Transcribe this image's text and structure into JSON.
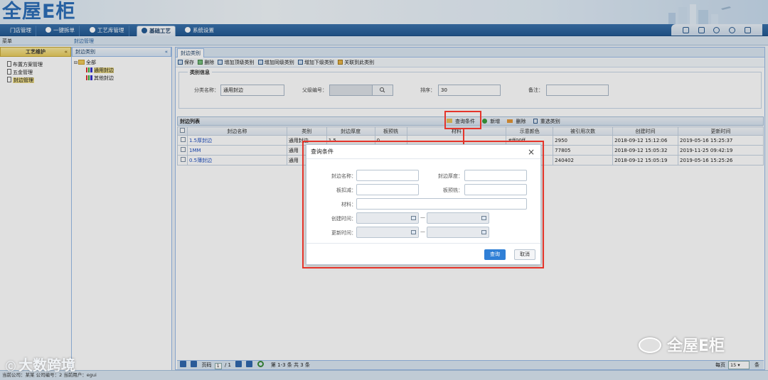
{
  "app": {
    "logo": "全屋E柜"
  },
  "nav": {
    "tabs": [
      "门店管理",
      "一键拆单",
      "工艺库管理",
      "基础工艺",
      "系统设置"
    ],
    "active": "基础工艺"
  },
  "crumbs": {
    "menu": "菜单",
    "path": "封边管理"
  },
  "left_nav": {
    "title": "工艺维护",
    "collapse": "«",
    "items": [
      "布置方案管理",
      "五金管理",
      "封边管理"
    ],
    "selected": "封边管理"
  },
  "tree": {
    "title": "封边类别",
    "collapse": "«",
    "root": "全部",
    "children": [
      "通用封边",
      "其他封边"
    ],
    "selected": "通用封边"
  },
  "main": {
    "tab": "封边类别",
    "toolbar": [
      "保存",
      "删除",
      "增加顶级类别",
      "增加同级类别",
      "增加下级类别",
      "关联到此类别"
    ],
    "category_info": {
      "legend": "类别信息",
      "name_label": "分类名称：",
      "name_value": "通用封边",
      "parent_label": "父级编号：",
      "order_label": "排序：",
      "order_value": "30",
      "remark_label": "备注："
    },
    "grid": {
      "title": "封边列表",
      "tools": [
        "查询条件",
        "新增",
        "删除",
        "重选类别"
      ],
      "columns": [
        "封边名称",
        "类别",
        "封边厚度",
        "板预铣",
        "材料",
        "示意颜色",
        "被引用次数",
        "创建时间",
        "更新时间"
      ],
      "rows": [
        [
          "1.5厚封边",
          "通用封边",
          "1.5",
          "0",
          "",
          "#ff00ff",
          "2950",
          "2018-09-12 15:12:06",
          "2019-05-16 15:25:37"
        ],
        [
          "1MM",
          "通用",
          "",
          "",
          "",
          "",
          "77805",
          "2018-09-12 15:05:32",
          "2019-11-25 09:42:19"
        ],
        [
          "0.5薄封边",
          "通用",
          "",
          "",
          "",
          "",
          "240402",
          "2018-09-12 15:05:19",
          "2019-05-16 15:25:26"
        ]
      ]
    },
    "pager": {
      "page_label": "页码",
      "page": "1",
      "of": "/ 1",
      "summary": "第 1-3 条  共 3 条",
      "per_page_label": "每页",
      "per_page": "15",
      "unit": "条"
    }
  },
  "status": "当前公司：某某  公司编号：2  当前用户：egui",
  "dialog": {
    "title": "查询条件",
    "close": "×",
    "fields": {
      "edge_name": "封边名称：",
      "edge_thickness": "封边厚度：",
      "board_deduct": "板扣减：",
      "board_premill": "板预铣：",
      "material": "材料：",
      "created": "创建时间：",
      "updated": "更新时间：",
      "range_sep": "—"
    },
    "query_btn": "查询",
    "cancel_btn": "取消"
  },
  "watermarks": {
    "left": "大数跨境",
    "right": "全屋E柜"
  },
  "colors": {
    "nav_blue": "#235a94",
    "highlight_red": "#e5352b",
    "query_blue": "#2f7fd6"
  }
}
